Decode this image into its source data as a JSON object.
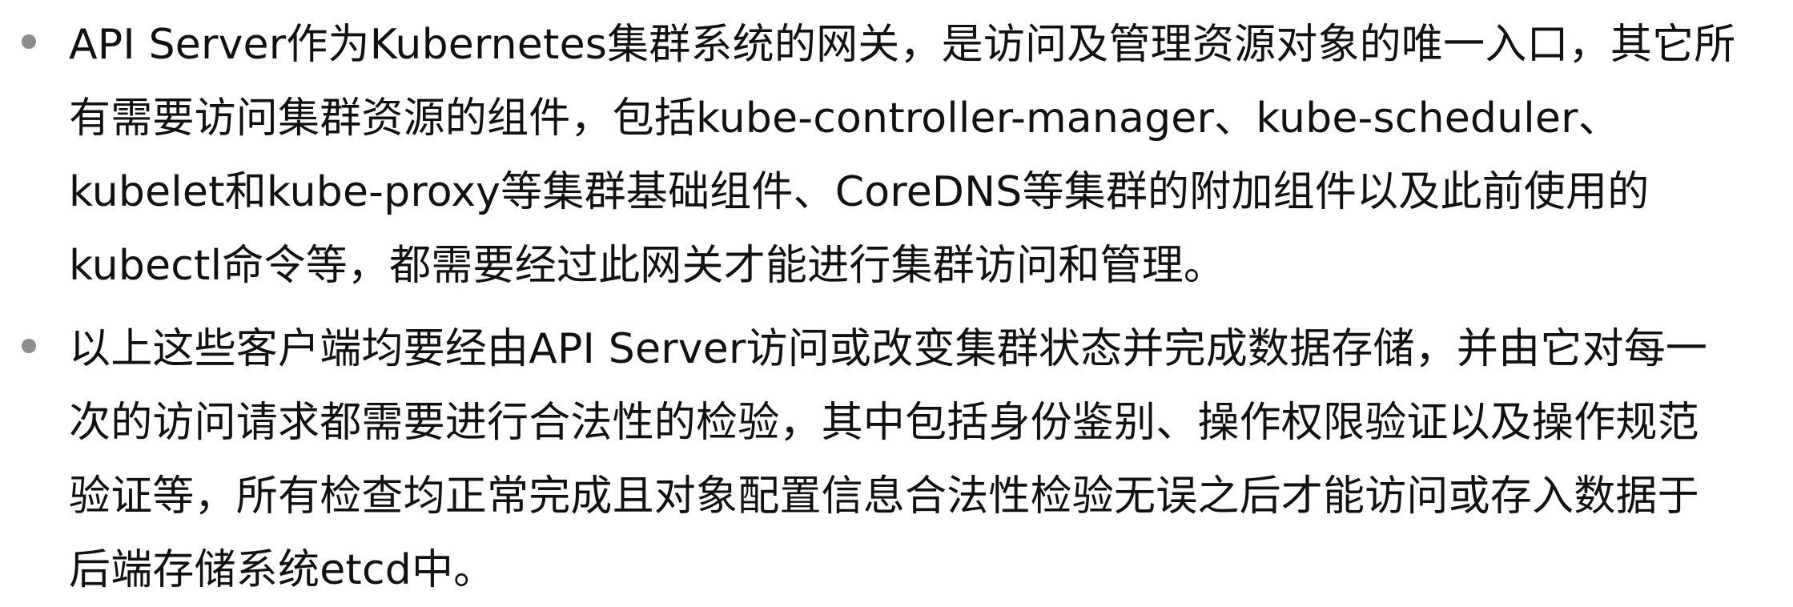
{
  "bullets": [
    {
      "lines": [
        "API Server作为Kubernetes集群系统的网关，是访问及管理资源对象的唯一入口，其它所",
        "有需要访问集群资源的组件，包括kube-controller-manager、kube-scheduler、",
        "kubelet和kube-proxy等集群基础组件、CoreDNS等集群的附加组件以及此前使用的",
        "kubectl命令等，都需要经过此网关才能进行集群访问和管理。"
      ]
    },
    {
      "lines": [
        "以上这些客户端均要经由API Server访问或改变集群状态并完成数据存储，并由它对每一",
        "次的访问请求都需要进行合法性的检验，其中包括身份鉴别、操作权限验证以及操作规范",
        "验证等，所有检查均正常完成且对象配置信息合法性检验无误之后才能访问或存入数据于",
        "后端存储系统etcd中。"
      ]
    }
  ]
}
